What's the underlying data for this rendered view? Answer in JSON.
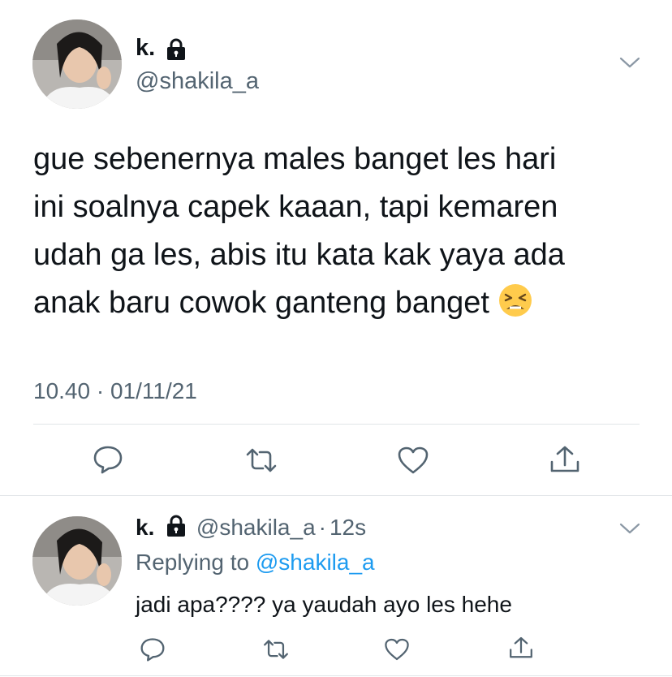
{
  "main_tweet": {
    "display_name": "k.",
    "handle": "@shakila_a",
    "text": "gue sebenernya males banget les hari ini soalnya capek kaaan, tapi kemaren udah ga les, abis itu kata kak yaya ada anak baru cowok ganteng banget",
    "text_lines": [
      "gue sebenernya males banget les hari",
      "ini soalnya capek kaaan, tapi kemaren",
      "udah ga les, abis itu kata kak yaya ada",
      "anak baru cowok ganteng banget"
    ],
    "emoji": "tired-face-emoji",
    "timestamp": "10.40 · 01/11/21"
  },
  "reply_tweet": {
    "display_name": "k.",
    "handle": "@shakila_a",
    "separator": "·",
    "time_ago": "12s",
    "replying_prefix": "Replying to",
    "replying_handle": "@shakila_a",
    "text": "jadi apa???? ya yaudah ayo les hehe"
  },
  "icons": {
    "more": "chevron-down-icon",
    "reply": "comment-icon",
    "retweet": "retweet-icon",
    "like": "heart-icon",
    "share": "share-icon",
    "protected": "lock-icon"
  },
  "colors": {
    "text": "#0f1419",
    "secondary": "#536471",
    "link": "#1d9bf0",
    "divider": "#e1e5e8"
  }
}
